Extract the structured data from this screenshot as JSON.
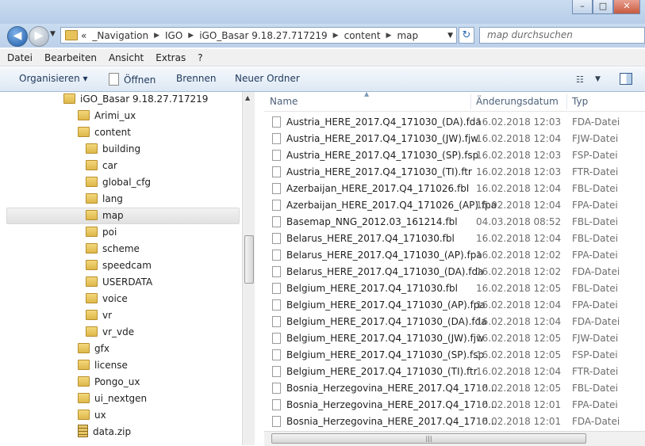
{
  "window": {
    "minimize": "–",
    "maximize": "□",
    "close": "✕"
  },
  "nav": {
    "back_glyph": "◀",
    "forward_glyph": "▶",
    "dropdown_glyph": "▼",
    "breadcrumb_prefix": "«",
    "breadcrumb": [
      "_Navigation",
      "IGO",
      "iGO_Basar 9.18.27.717219",
      "content",
      "map"
    ],
    "separator_glyph": "▶",
    "refresh_glyph": "↻",
    "search_placeholder": "map durchsuchen"
  },
  "menu": [
    "Datei",
    "Bearbeiten",
    "Ansicht",
    "Extras",
    "?"
  ],
  "toolbar": {
    "organize": "Organisieren ▾",
    "open": "Öffnen",
    "burn": "Brennen",
    "new_folder": "Neuer Ordner",
    "view_glyph": "☷",
    "view_drop": "▼"
  },
  "tree": [
    {
      "label": "iGO_Basar 9.18.27.717219",
      "indent": 0,
      "icon": "folder-icon"
    },
    {
      "label": "Arimi_ux",
      "indent": 1,
      "icon": "folder-icon"
    },
    {
      "label": "content",
      "indent": 1,
      "icon": "folder-icon"
    },
    {
      "label": "building",
      "indent": 2,
      "icon": "folder-icon"
    },
    {
      "label": "car",
      "indent": 2,
      "icon": "folder-icon"
    },
    {
      "label": "global_cfg",
      "indent": 2,
      "icon": "folder-icon"
    },
    {
      "label": "lang",
      "indent": 2,
      "icon": "folder-icon"
    },
    {
      "label": "map",
      "indent": 2,
      "icon": "folder-icon",
      "selected": true
    },
    {
      "label": "poi",
      "indent": 2,
      "icon": "folder-icon"
    },
    {
      "label": "scheme",
      "indent": 2,
      "icon": "folder-icon"
    },
    {
      "label": "speedcam",
      "indent": 2,
      "icon": "folder-icon"
    },
    {
      "label": "USERDATA",
      "indent": 2,
      "icon": "folder-icon"
    },
    {
      "label": "voice",
      "indent": 2,
      "icon": "folder-icon"
    },
    {
      "label": "vr",
      "indent": 2,
      "icon": "folder-icon"
    },
    {
      "label": "vr_vde",
      "indent": 2,
      "icon": "folder-icon"
    },
    {
      "label": "gfx",
      "indent": 1,
      "icon": "folder-icon"
    },
    {
      "label": "license",
      "indent": 1,
      "icon": "folder-icon"
    },
    {
      "label": "Pongo_ux",
      "indent": 1,
      "icon": "folder-icon"
    },
    {
      "label": "ui_nextgen",
      "indent": 1,
      "icon": "folder-icon"
    },
    {
      "label": "ux",
      "indent": 1,
      "icon": "folder-icon"
    },
    {
      "label": "data.zip",
      "indent": 1,
      "icon": "zip-icon"
    }
  ],
  "columns": {
    "name": "Name",
    "date": "Änderungsdatum",
    "type": "Typ"
  },
  "files": [
    {
      "name": "Austria_HERE_2017.Q4_171030_(DA).fda",
      "date": "16.02.2018 12:03",
      "type": "FDA-Datei"
    },
    {
      "name": "Austria_HERE_2017.Q4_171030_(JW).fjw",
      "date": "16.02.2018 12:04",
      "type": "FJW-Datei"
    },
    {
      "name": "Austria_HERE_2017.Q4_171030_(SP).fsp",
      "date": "16.02.2018 12:03",
      "type": "FSP-Datei"
    },
    {
      "name": "Austria_HERE_2017.Q4_171030_(TI).ftr",
      "date": "16.02.2018 12:03",
      "type": "FTR-Datei"
    },
    {
      "name": "Azerbaijan_HERE_2017.Q4_171026.fbl",
      "date": "16.02.2018 12:04",
      "type": "FBL-Datei"
    },
    {
      "name": "Azerbaijan_HERE_2017.Q4_171026_(AP).fpa",
      "date": "16.02.2018 12:04",
      "type": "FPA-Datei"
    },
    {
      "name": "Basemap_NNG_2012.03_161214.fbl",
      "date": "04.03.2018 08:52",
      "type": "FBL-Datei",
      "highlighted": true
    },
    {
      "name": "Belarus_HERE_2017.Q4_171030.fbl",
      "date": "16.02.2018 12:04",
      "type": "FBL-Datei"
    },
    {
      "name": "Belarus_HERE_2017.Q4_171030_(AP).fpa",
      "date": "16.02.2018 12:02",
      "type": "FPA-Datei"
    },
    {
      "name": "Belarus_HERE_2017.Q4_171030_(DA).fda",
      "date": "16.02.2018 12:02",
      "type": "FDA-Datei"
    },
    {
      "name": "Belgium_HERE_2017.Q4_171030.fbl",
      "date": "16.02.2018 12:05",
      "type": "FBL-Datei"
    },
    {
      "name": "Belgium_HERE_2017.Q4_171030_(AP).fpa",
      "date": "16.02.2018 12:04",
      "type": "FPA-Datei"
    },
    {
      "name": "Belgium_HERE_2017.Q4_171030_(DA).fda",
      "date": "16.02.2018 12:04",
      "type": "FDA-Datei"
    },
    {
      "name": "Belgium_HERE_2017.Q4_171030_(JW).fjw",
      "date": "16.02.2018 12:05",
      "type": "FJW-Datei"
    },
    {
      "name": "Belgium_HERE_2017.Q4_171030_(SP).fsp",
      "date": "16.02.2018 12:05",
      "type": "FSP-Datei"
    },
    {
      "name": "Belgium_HERE_2017.Q4_171030_(TI).ftr",
      "date": "16.02.2018 12:04",
      "type": "FTR-Datei"
    },
    {
      "name": "Bosnia_Herzegovina_HERE_2017.Q4_1710...",
      "date": "16.02.2018 12:05",
      "type": "FBL-Datei"
    },
    {
      "name": "Bosnia_Herzegovina_HERE_2017.Q4_1710...",
      "date": "16.02.2018 12:01",
      "type": "FPA-Datei"
    },
    {
      "name": "Bosnia_Herzegovina_HERE_2017.Q4_1710...",
      "date": "16.02.2018 12:01",
      "type": "FDA-Datei"
    }
  ],
  "scroll": {
    "up": "▲",
    "down": "▼",
    "grip": "|||"
  }
}
